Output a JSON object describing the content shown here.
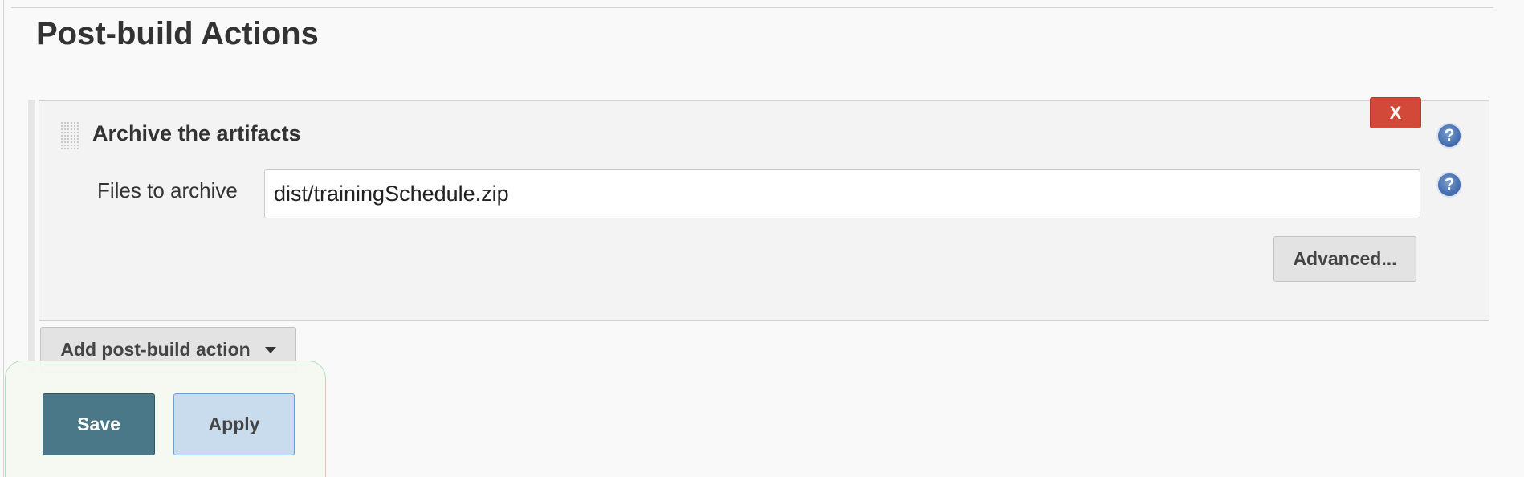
{
  "section": {
    "title": "Post-build Actions"
  },
  "action": {
    "title": "Archive the artifacts",
    "delete_label": "X",
    "help_symbol": "?",
    "files_label": "Files to archive",
    "files_value": "dist/trainingSchedule.zip",
    "advanced_label": "Advanced..."
  },
  "add_action": {
    "label": "Add post-build action",
    "icon": "caret-down-icon"
  },
  "footer": {
    "save_label": "Save",
    "apply_label": "Apply"
  },
  "colors": {
    "delete_button": "#d24939",
    "save_button": "#4a7888",
    "apply_button": "#c9dcee",
    "help_icon": "#4a73b3",
    "bottom_bar_border": "#b5dbbf"
  },
  "icons": {
    "drag_handle": "drag-handle-icon",
    "help": "help-icon",
    "caret": "caret-down-icon"
  }
}
